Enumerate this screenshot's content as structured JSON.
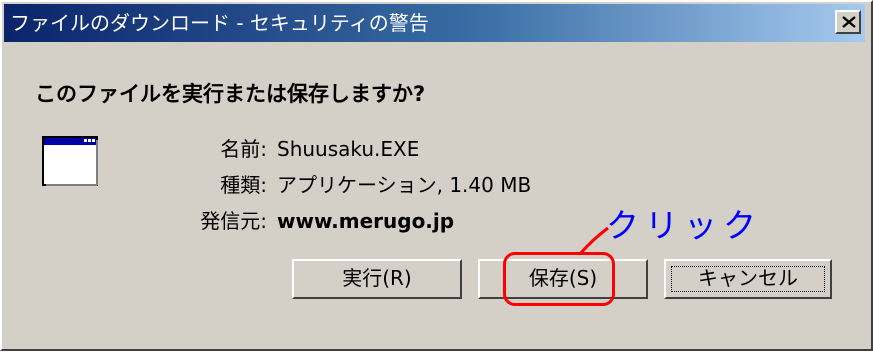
{
  "dialog": {
    "title": "ファイルのダウンロード - セキュリティの警告",
    "question": "このファイルを実行または保存しますか?",
    "file_icon": "application-window-icon",
    "close_icon": "close-x-icon"
  },
  "file_info": {
    "name_label": "名前:",
    "name_value": "Shuusaku.EXE",
    "type_label": "種類:",
    "type_value": "アプリケーション, 1.40 MB",
    "from_label": "発信元:",
    "from_value": "www.merugo.jp"
  },
  "buttons": {
    "run_label": "実行(R)",
    "save_label": "保存(S)",
    "cancel_label": "キャンセル"
  },
  "annotation": {
    "text": "クリック",
    "color": "#0000ff",
    "highlight_color": "#ff0000"
  },
  "colors": {
    "title_gradient_start": "#0a246a",
    "title_gradient_end": "#a6caf0",
    "face": "#d4d0c8"
  }
}
